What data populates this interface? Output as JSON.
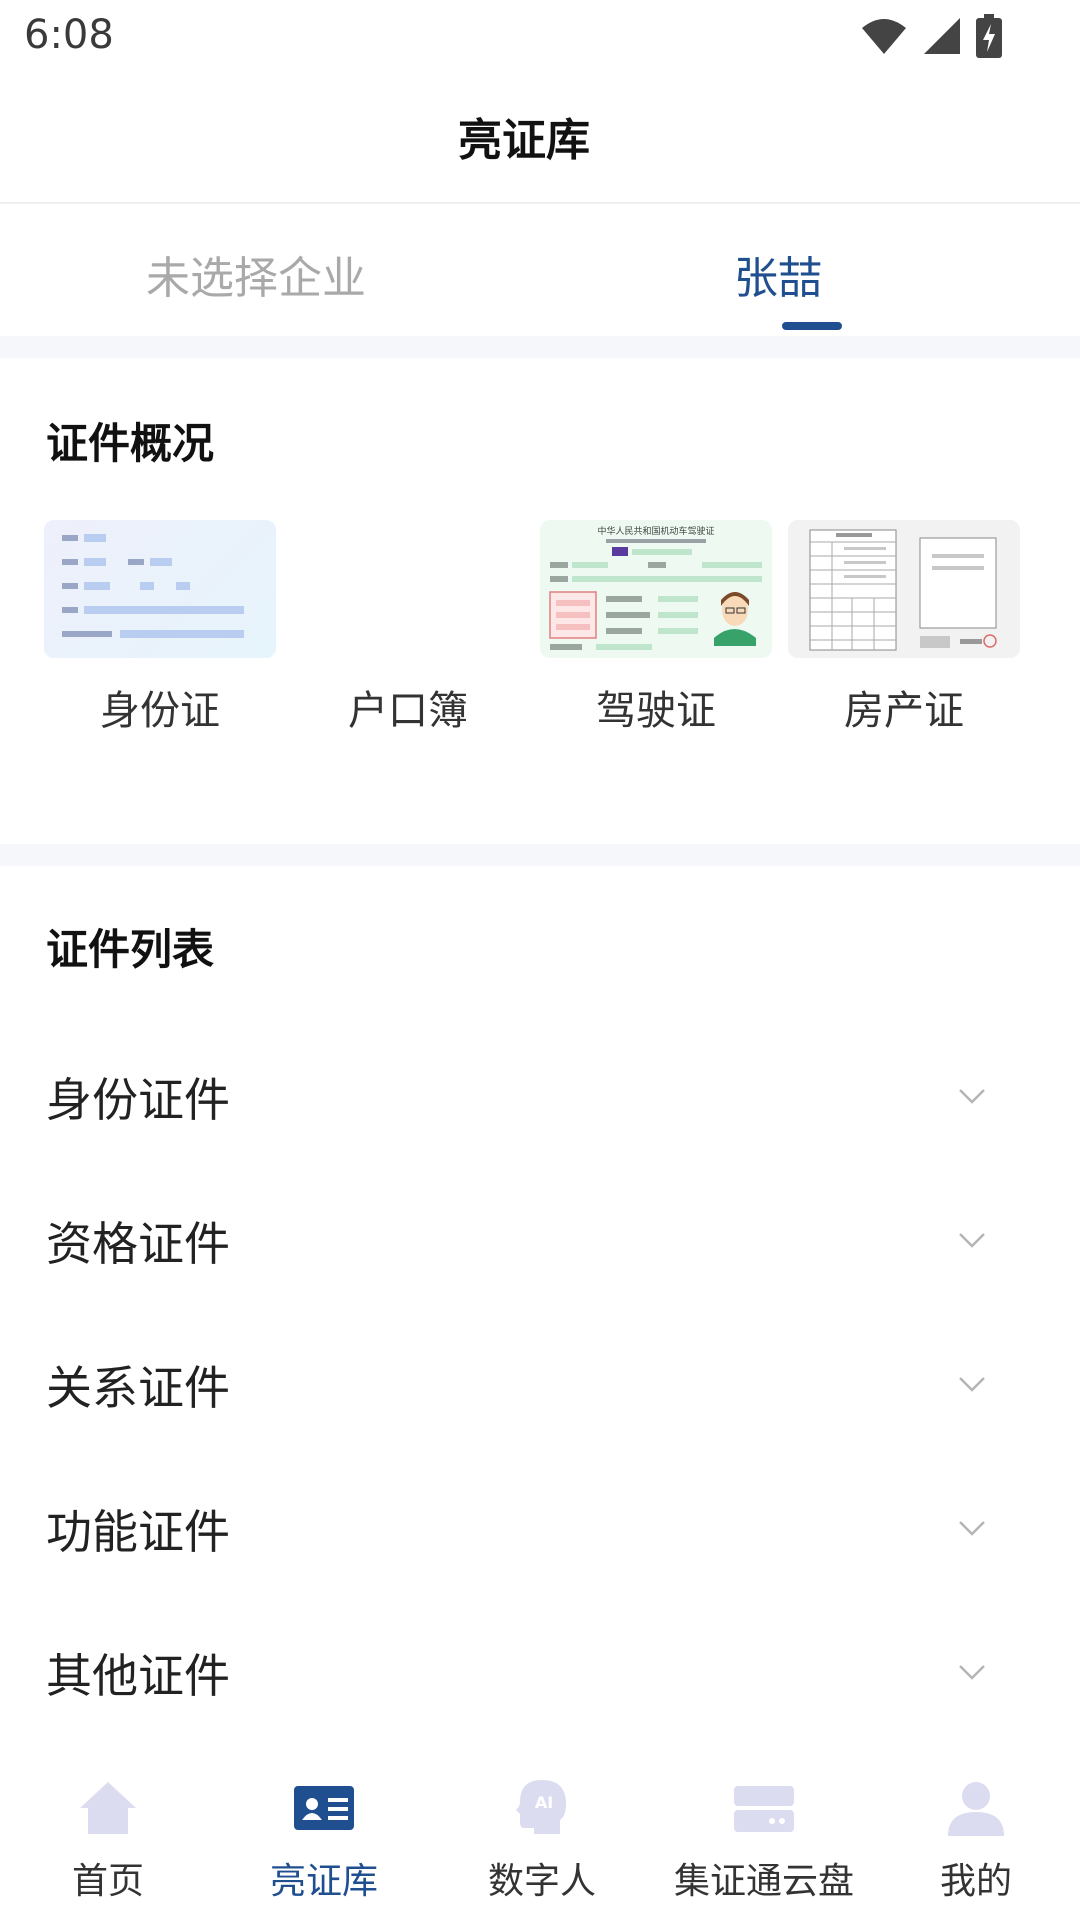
{
  "status_bar": {
    "time": "6:08"
  },
  "header": {
    "title": "亮证库"
  },
  "tabs": [
    {
      "label": "未选择企业",
      "active": false
    },
    {
      "label": "张喆",
      "active": true
    }
  ],
  "overview": {
    "title": "证件概况",
    "cards": [
      {
        "label": "身份证",
        "thumb": "id-card-thumbnail"
      },
      {
        "label": "户口簿",
        "thumb": "none"
      },
      {
        "label": "驾驶证",
        "thumb": "driving-license-thumbnail"
      },
      {
        "label": "房产证",
        "thumb": "property-certificate-thumbnail"
      }
    ],
    "driving_license_heading": "中华人民共和国机动车驾驶证"
  },
  "list": {
    "title": "证件列表",
    "items": [
      {
        "label": "身份证件"
      },
      {
        "label": "资格证件"
      },
      {
        "label": "关系证件"
      },
      {
        "label": "功能证件"
      },
      {
        "label": "其他证件"
      }
    ]
  },
  "bottom_nav": {
    "items": [
      {
        "label": "首页",
        "icon": "home-icon",
        "active": false
      },
      {
        "label": "亮证库",
        "icon": "id-card-icon",
        "active": true
      },
      {
        "label": "数字人",
        "icon": "ai-avatar-icon",
        "active": false
      },
      {
        "label": "集证通云盘",
        "icon": "cloud-drive-icon",
        "active": false
      },
      {
        "label": "我的",
        "icon": "user-icon",
        "active": false
      }
    ]
  },
  "colors": {
    "accent": "#1f4f8f",
    "inactive_nav_icon": "#dcdcf0",
    "inactive_tab": "#a9a9a9",
    "section_gap": "#f5f7fa"
  }
}
